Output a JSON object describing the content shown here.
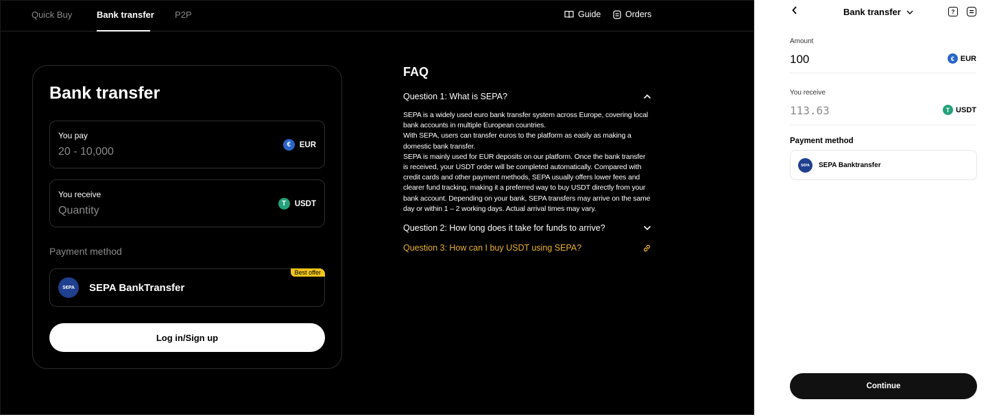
{
  "desktop": {
    "tabs": [
      {
        "label": "Quick Buy"
      },
      {
        "label": "Bank transfer"
      },
      {
        "label": "P2P"
      }
    ],
    "nav_links": {
      "guide": "Guide",
      "orders": "Orders"
    },
    "card": {
      "title": "Bank transfer",
      "pay": {
        "label": "You pay",
        "placeholder": "20 - 10,000",
        "currency": "EUR",
        "currency_icon": "euro-coin-icon"
      },
      "receive": {
        "label": "You receive",
        "placeholder": "Quantity",
        "currency": "USDT",
        "currency_icon": "tether-coin-icon"
      },
      "payment_method_label": "Payment method",
      "payment_method": {
        "name": "SEPA BankTransfer",
        "badge": "Best offer",
        "logo_text": "S€PA"
      },
      "login_button": "Log in/Sign up"
    },
    "faq": {
      "title": "FAQ",
      "items": [
        {
          "question": "Question 1: What is SEPA?",
          "expanded": true,
          "answer_lines": [
            "SEPA is a widely used euro bank transfer system across Europe, covering local bank accounts in multiple European countries.",
            "With SEPA, users can transfer euros to the platform as easily as making a domestic bank transfer.",
            "SEPA is mainly used for EUR deposits on our platform. Once the bank transfer is received, your USDT order will be completed automatically. Compared with credit cards and other payment methods, SEPA usually offers lower fees and clearer fund tracking, making it a preferred way to buy USDT directly from your bank account. Depending on your bank, SEPA transfers may arrive on the same day or within 1 – 2 working days. Actual arrival times may vary."
          ]
        },
        {
          "question": "Question 2: How long does it take for funds to arrive?",
          "expanded": false
        },
        {
          "question": "Question 3: How can I buy USDT using SEPA?",
          "expanded": false
        }
      ]
    }
  },
  "mobile": {
    "header_title": "Bank transfer",
    "amount_label": "Amount",
    "amount_value": "100",
    "amount_currency": "EUR",
    "receive_label": "You receive",
    "receive_value": "113.63",
    "receive_currency": "USDT",
    "payment_method_label": "Payment method",
    "payment_method_name": "SEPA Banktransfer",
    "continue_button": "Continue"
  },
  "colors": {
    "accent_gold": "#e9b12c",
    "badge_yellow": "#f0c419",
    "eur_blue": "#2a66c9",
    "usdt_green": "#24a17b",
    "sepa_blue": "#1f3f8f"
  }
}
